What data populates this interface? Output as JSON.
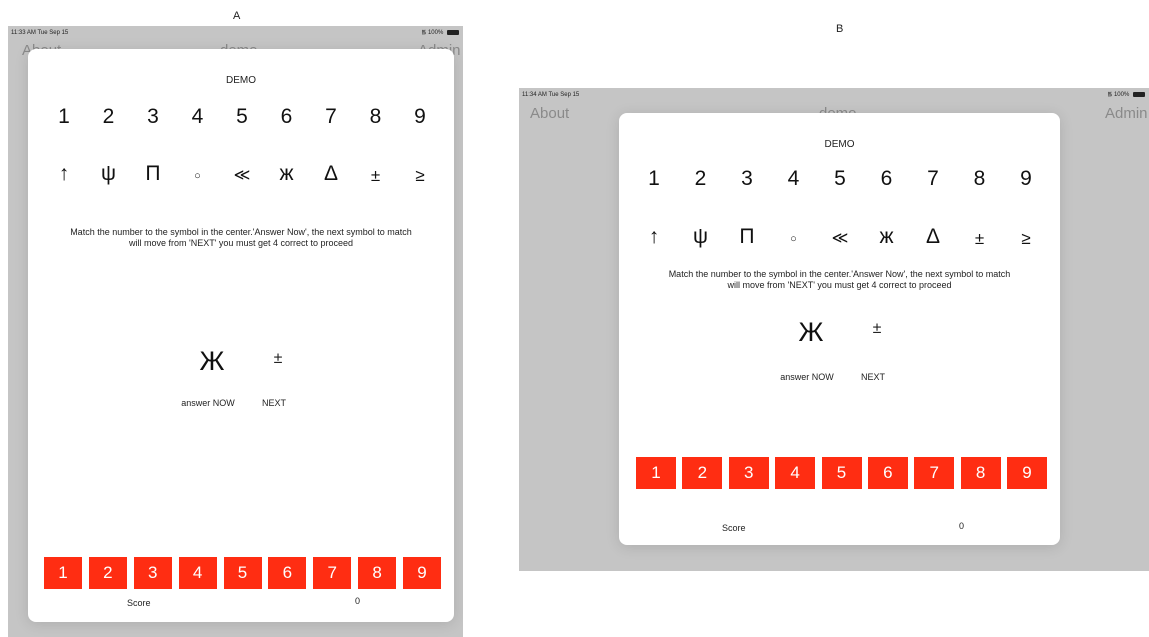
{
  "panels": {
    "a": {
      "label": "A",
      "status_time": "11:33 AM  Tue Sep 15",
      "status_battery": "100%",
      "nav_left": "About",
      "nav_center": "demo",
      "nav_right": "Admin",
      "title": "DEMO",
      "answer_symbol": "Ж",
      "next_symbol": "±",
      "score_value": "0"
    },
    "b": {
      "label": "B",
      "status_time": "11:34 AM  Tue Sep 15",
      "status_battery": "100%",
      "nav_left": "About",
      "nav_center": "demo",
      "nav_right": "Admin",
      "title": "DEMO",
      "answer_symbol": "Ж",
      "next_symbol": "±",
      "score_value": "0"
    }
  },
  "key_numbers": [
    "1",
    "2",
    "3",
    "4",
    "5",
    "6",
    "7",
    "8",
    "9"
  ],
  "key_symbols": [
    "↑",
    "ψ",
    "Π",
    "○",
    "≪",
    "ж",
    "Δ",
    "±",
    "≥"
  ],
  "instructions_line1": "Match the number to the symbol in the center.'Answer Now', the next symbol to match",
  "instructions_line2": "will move from 'NEXT' you must get 4 correct to proceed",
  "answer_label": "answer NOW",
  "next_label": "NEXT",
  "score_label": "Score",
  "answer_buttons": [
    "1",
    "2",
    "3",
    "4",
    "5",
    "6",
    "7",
    "8",
    "9"
  ],
  "colors": {
    "button": "#ff2d12",
    "backdrop": "#c5c5c5",
    "modal": "#ffffff"
  }
}
